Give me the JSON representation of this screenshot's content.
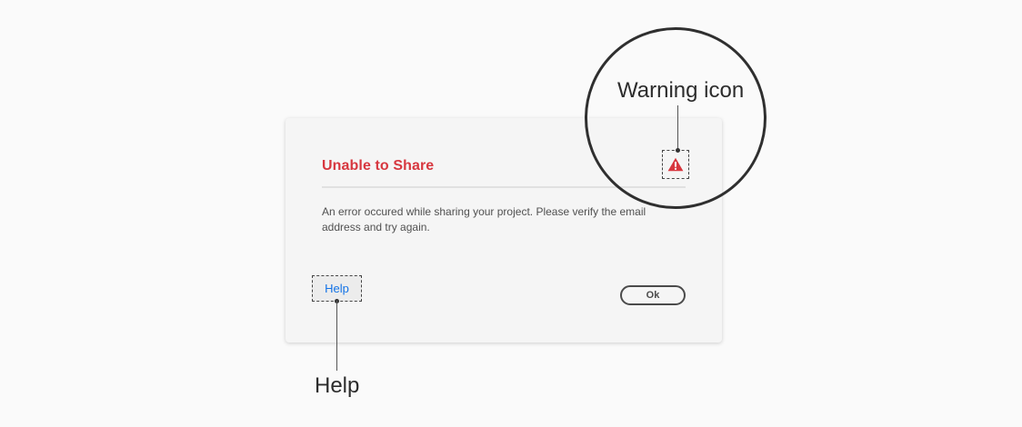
{
  "dialog": {
    "title": "Unable to Share",
    "body": "An error occured while sharing your project. Please verify the email address and try again.",
    "help_label": "Help",
    "ok_label": "Ok",
    "warning_icon": "warning-triangle-icon"
  },
  "annotations": {
    "warning_label": "Warning icon",
    "help_label": "Help"
  },
  "colors": {
    "title": "#d7373f",
    "warning": "#d7373f",
    "link": "#1473e6",
    "button_border": "#4b4b4b"
  }
}
